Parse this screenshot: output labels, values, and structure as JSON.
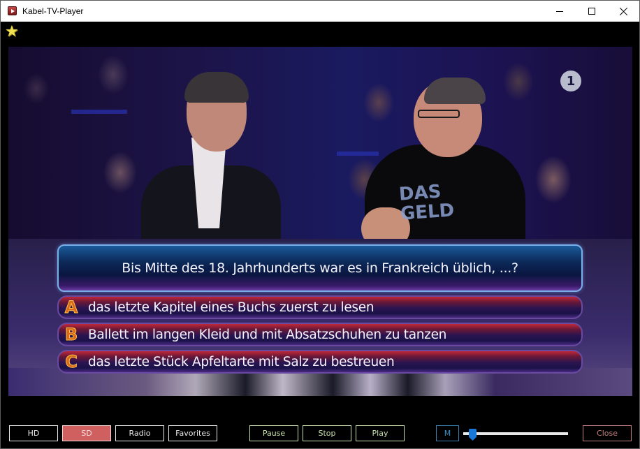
{
  "window": {
    "title": "Kabel-TV-Player",
    "icon": "app-play-icon",
    "controls": {
      "minimize": "minimize-icon",
      "maximize": "maximize-icon",
      "close": "close-icon"
    }
  },
  "favorite_star": {
    "icon": "star-icon",
    "glyph": "★"
  },
  "video": {
    "channel_logo": "1",
    "shirt_print": "DAS\nGELD",
    "quiz": {
      "question": "Bis Mitte des 18. Jahrhunderts war es in Frankreich üblich, ...?",
      "answers": [
        {
          "letter": "A",
          "text": "das letzte Kapitel eines Buchs zuerst zu lesen"
        },
        {
          "letter": "B",
          "text": "Ballett im langen Kleid und mit Absatzschuhen zu tanzen"
        },
        {
          "letter": "C",
          "text": "das letzte Stück Apfeltarte mit Salz zu bestreuen"
        }
      ]
    }
  },
  "controls": {
    "quality": [
      {
        "label": "HD",
        "active": false
      },
      {
        "label": "SD",
        "active": true
      }
    ],
    "radio_label": "Radio",
    "favorites_label": "Favorites",
    "pause_label": "Pause",
    "stop_label": "Stop",
    "play_label": "Play",
    "mute_label": "M",
    "volume_percent": 6,
    "close_label": "Close"
  },
  "colors": {
    "active_quality": "#d06060",
    "playback_border": "#c8e0b0",
    "mute_border": "#3a80b0",
    "close_border": "#c08080",
    "slider_thumb": "#1a78d8"
  }
}
